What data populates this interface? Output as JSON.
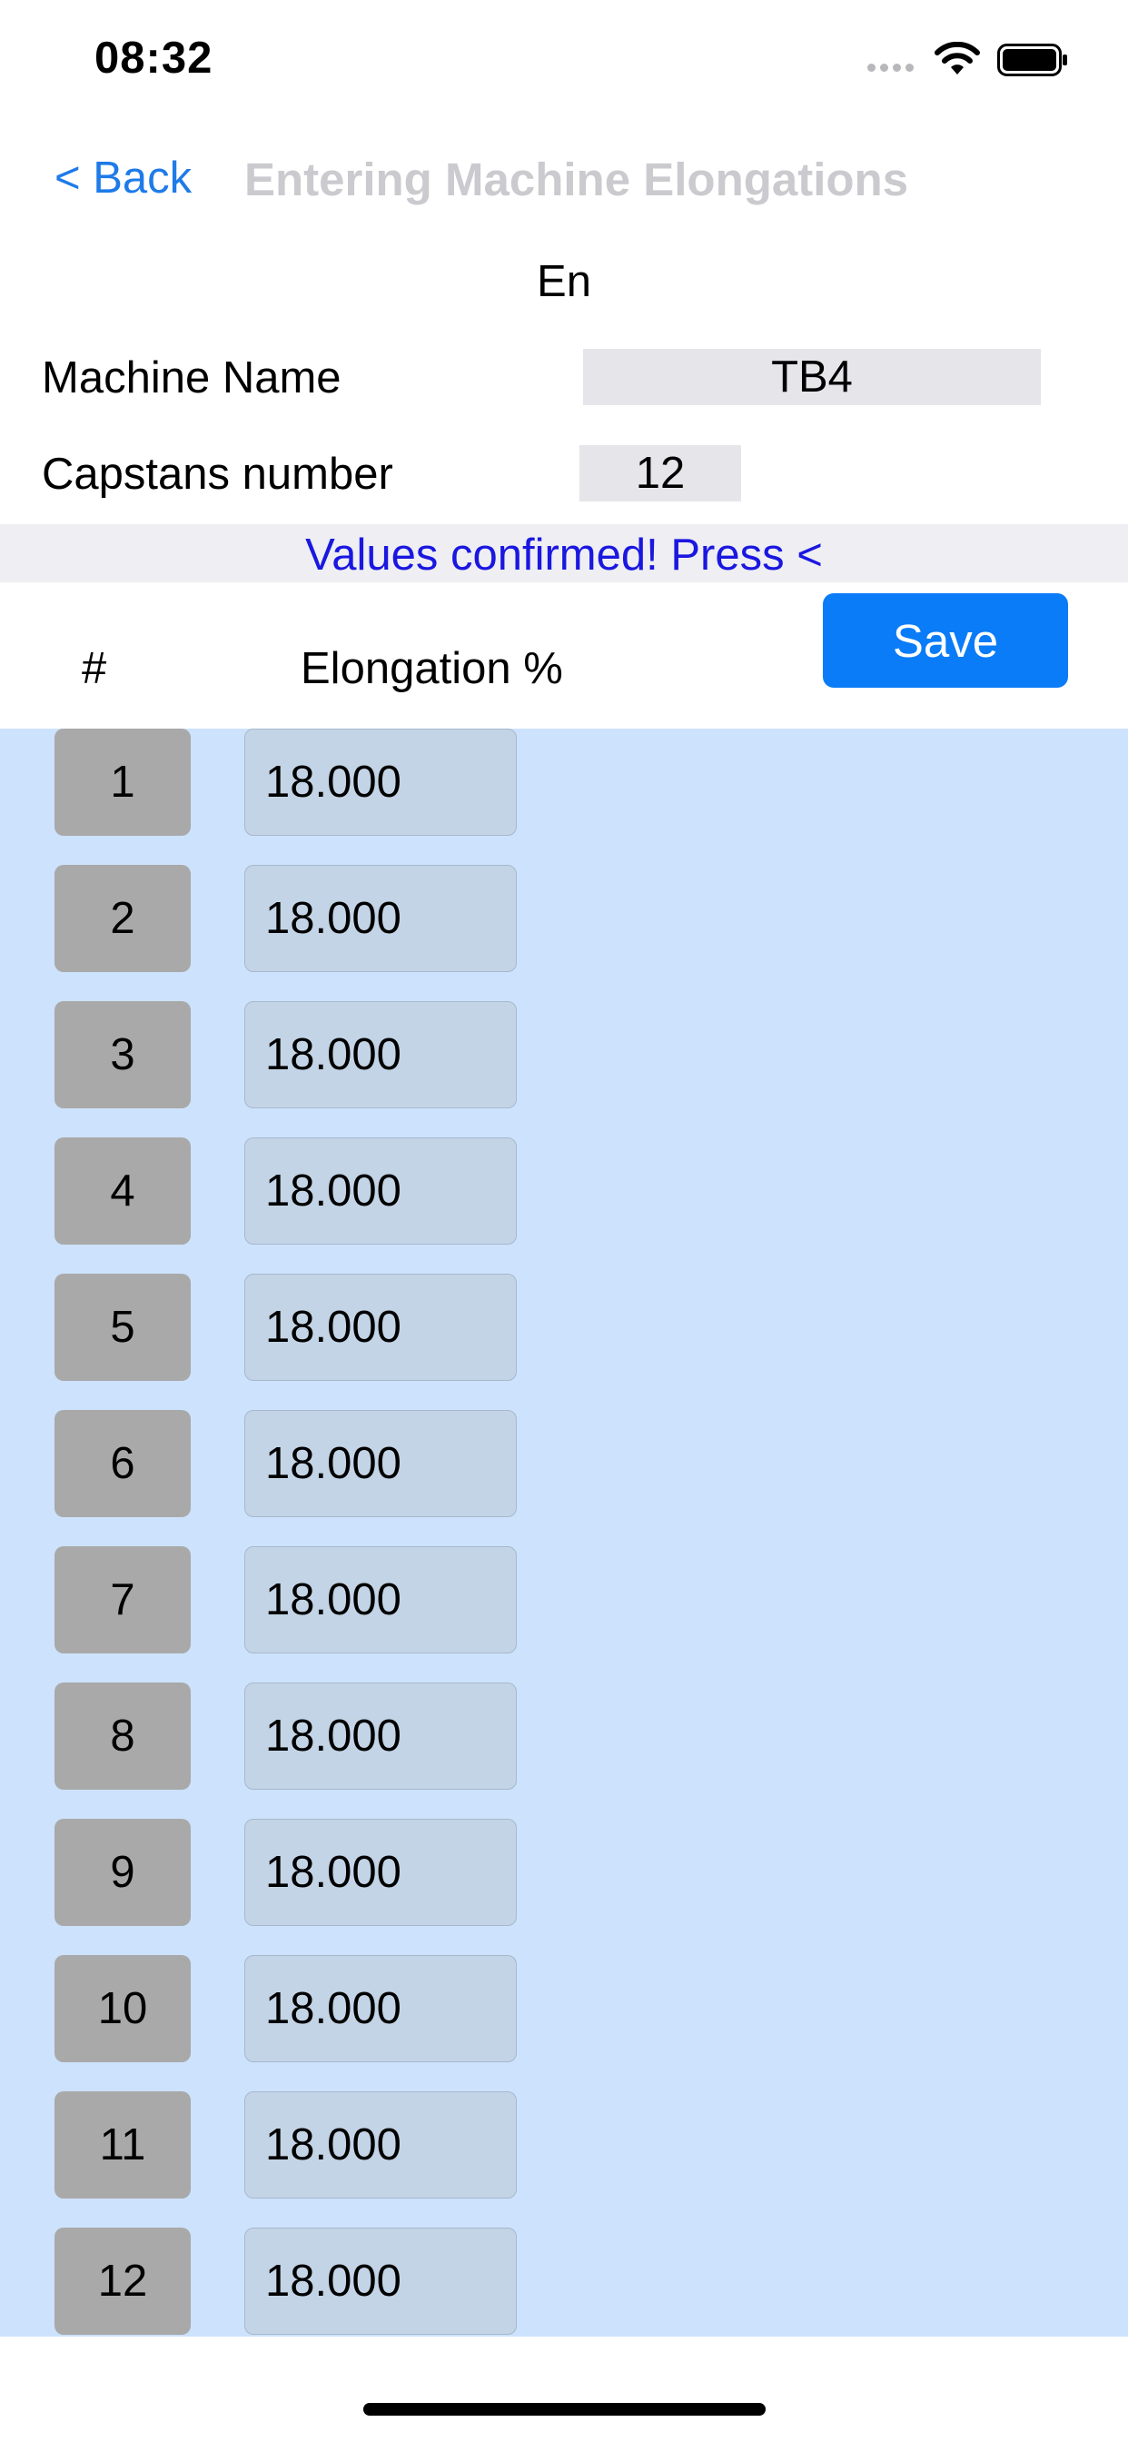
{
  "status_bar": {
    "time": "08:32"
  },
  "nav": {
    "back_label": "< Back",
    "title": "Entering Machine Elongations"
  },
  "language": "En",
  "machine": {
    "name_label": "Machine Name",
    "name_value": "TB4",
    "capstans_label": "Capstans number",
    "capstans_value": "12"
  },
  "status_message": "Values confirmed! Press <",
  "table": {
    "col_index": "#",
    "col_elongation": "Elongation %",
    "save_label": "Save",
    "rows": [
      {
        "index": "1",
        "value": "18.000"
      },
      {
        "index": "2",
        "value": "18.000"
      },
      {
        "index": "3",
        "value": "18.000"
      },
      {
        "index": "4",
        "value": "18.000"
      },
      {
        "index": "5",
        "value": "18.000"
      },
      {
        "index": "6",
        "value": "18.000"
      },
      {
        "index": "7",
        "value": "18.000"
      },
      {
        "index": "8",
        "value": "18.000"
      },
      {
        "index": "9",
        "value": "18.000"
      },
      {
        "index": "10",
        "value": "18.000"
      },
      {
        "index": "11",
        "value": "18.000"
      },
      {
        "index": "12",
        "value": "18.000"
      }
    ]
  },
  "colors": {
    "accent": "#0a7cf8",
    "link": "#1e7be8",
    "status_text": "#1a17e0",
    "list_background": "#cde2fc"
  }
}
